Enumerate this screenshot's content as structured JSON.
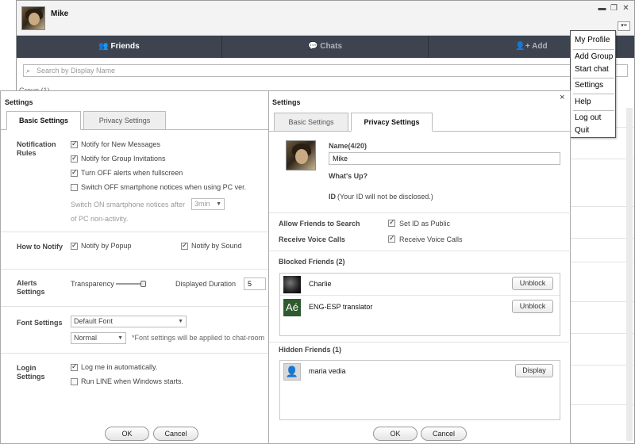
{
  "main": {
    "user_name": "Mike",
    "tabs": [
      {
        "label": "Friends",
        "icon": "friends-icon"
      },
      {
        "label": "Chats",
        "icon": "chat-icon"
      },
      {
        "label": "Add",
        "icon": "add-user-icon"
      }
    ],
    "search_placeholder": "Search by Display Name",
    "group_header": "Group (1)"
  },
  "context_menu": {
    "items": [
      "My Profile",
      "Add Group",
      "Start chat",
      "Settings",
      "Help",
      "Log out",
      "Quit"
    ]
  },
  "basic_settings": {
    "title": "Settings",
    "tabs": {
      "basic": "Basic Settings",
      "privacy": "Privacy Settings"
    },
    "notification_rules": {
      "label": "Notification Rules",
      "options": [
        {
          "label": "Notify for New Messages",
          "checked": true
        },
        {
          "label": "Notify for Group Invitations",
          "checked": true
        },
        {
          "label": "Turn OFF alerts when fullscreen",
          "checked": true
        },
        {
          "label": "Switch OFF smartphone notices when using PC ver.",
          "checked": false
        }
      ],
      "switch_on_prefix": "Switch ON smartphone notices after",
      "switch_on_value": "3min",
      "switch_on_suffix": "of PC non-activity."
    },
    "how_to_notify": {
      "label": "How to Notify",
      "popup": {
        "label": "Notify by Popup",
        "checked": true
      },
      "sound": {
        "label": "Notify by Sound",
        "checked": true
      }
    },
    "alerts": {
      "label": "Alerts Settings",
      "transparency_label": "Transparency",
      "duration_label": "Displayed Duration",
      "duration_value": "5",
      "transparency_level": 0.92
    },
    "font": {
      "label": "Font Settings",
      "family": "Default Font",
      "style": "Normal",
      "note": "*Font settings will be applied to chat-room"
    },
    "login": {
      "label": "Login Settings",
      "options": [
        {
          "label": "Log me in automatically.",
          "checked": true
        },
        {
          "label": "Run LINE when Windows starts.",
          "checked": false
        }
      ]
    },
    "ok": "OK",
    "cancel": "Cancel"
  },
  "privacy_settings": {
    "title": "Settings",
    "close": "×",
    "tabs": {
      "basic": "Basic Settings",
      "privacy": "Privacy Settings"
    },
    "name_label": "Name(4/20)",
    "name_value": "Mike",
    "whats_up_label": "What's Up?",
    "id_label": "ID",
    "id_note": "(Your ID will not be disclosed.)",
    "allow_search_label": "Allow Friends to Search",
    "set_id_public": {
      "label": "Set ID as Public",
      "checked": true
    },
    "voice_calls_label": "Receive Voice Calls",
    "receive_voice": {
      "label": "Receive Voice Calls",
      "checked": true
    },
    "blocked_header": "Blocked Friends (2)",
    "blocked": [
      {
        "name": "Charlie",
        "action": "Unblock"
      },
      {
        "name": "ENG-ESP translator",
        "action": "Unblock",
        "thumb_text": "Aé"
      }
    ],
    "hidden_header": "Hidden Friends (1)",
    "hidden": [
      {
        "name": "maria vedia",
        "action": "Display"
      }
    ],
    "ok": "OK",
    "cancel": "Cancel"
  }
}
